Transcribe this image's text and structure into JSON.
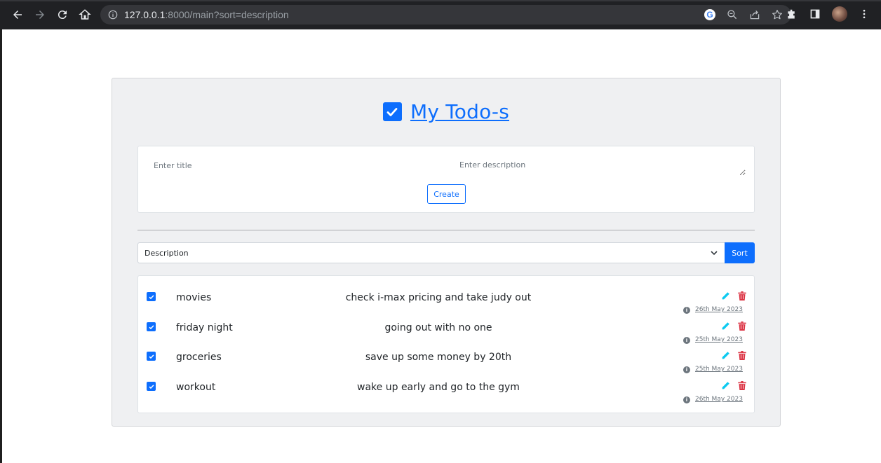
{
  "browser": {
    "url_host": "127.0.0.1",
    "url_rest": ":8000/main?sort=description",
    "icons": [
      "back-icon",
      "forward-icon",
      "reload-icon",
      "home-icon",
      "info-icon",
      "google-icon",
      "zoom-icon",
      "share-icon",
      "star-icon",
      "extensions-icon",
      "side-panel-icon",
      "profile-avatar",
      "menu-icon"
    ]
  },
  "header": {
    "title": "My Todo-s"
  },
  "form": {
    "title_placeholder": "Enter title",
    "description_placeholder": "Enter description",
    "create_label": "Create"
  },
  "sort": {
    "selected": "Description",
    "button_label": "Sort"
  },
  "todos": [
    {
      "title": "movies",
      "description": "check i-max pricing and take judy out",
      "date": "26th May 2023",
      "done": true
    },
    {
      "title": "friday night",
      "description": "going out with no one",
      "date": "25th May 2023",
      "done": true
    },
    {
      "title": "groceries",
      "description": "save up some money by 20th",
      "date": "25th May 2023",
      "done": true
    },
    {
      "title": "workout",
      "description": "wake up early and go to the gym",
      "date": "26th May 2023",
      "done": true
    }
  ],
  "colors": {
    "primary": "#0d6efd",
    "edit": "#0dcaf0",
    "delete": "#dc3545",
    "card_bg": "#eff0f2"
  }
}
